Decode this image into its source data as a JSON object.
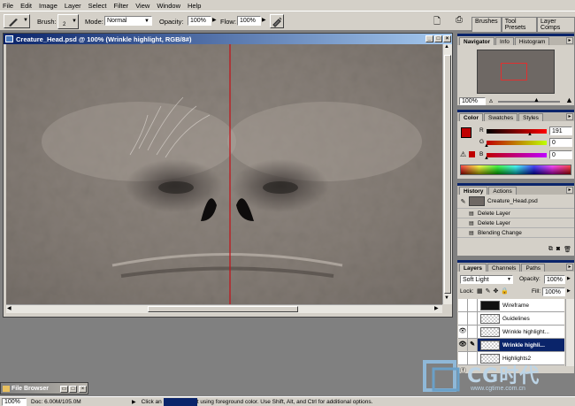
{
  "menu": [
    "File",
    "Edit",
    "Image",
    "Layer",
    "Select",
    "Filter",
    "View",
    "Window",
    "Help"
  ],
  "options": {
    "brush_label": "Brush:",
    "brush_size": "2",
    "mode_label": "Mode:",
    "mode_value": "Normal",
    "opacity_label": "Opacity:",
    "opacity_value": "100%",
    "flow_label": "Flow:",
    "flow_value": "100%",
    "palette_well_tabs": [
      "Brushes",
      "Tool Presets",
      "Layer Comps"
    ]
  },
  "document": {
    "title": "Creature_Head.psd @ 100% (Wrinkle highlight, RGB/8#)",
    "guide_color": "#c0161c"
  },
  "navigator": {
    "tabs": [
      "Navigator",
      "Info",
      "Histogram"
    ],
    "zoom": "100%",
    "view_box_color": "#e03030"
  },
  "color": {
    "tabs": [
      "Color",
      "Swatches",
      "Styles"
    ],
    "r_label": "R",
    "g_label": "G",
    "b_label": "B",
    "r_value": "191",
    "g_value": "0",
    "b_value": "0",
    "foreground": "#bf0000"
  },
  "history": {
    "tabs": [
      "History",
      "Actions"
    ],
    "snapshot": "Creature_Head.psd",
    "steps": [
      "Delete Layer",
      "Delete Layer",
      "Blending Change"
    ]
  },
  "layers": {
    "tabs": [
      "Layers",
      "Channels",
      "Paths"
    ],
    "blend_mode": "Soft Light",
    "opacity_label": "Opacity:",
    "opacity_value": "100%",
    "lock_label": "Lock:",
    "fill_label": "Fill:",
    "fill_value": "100%",
    "items": [
      {
        "name": "Wireframe",
        "visible": false,
        "active": false
      },
      {
        "name": "Guidelines",
        "visible": false,
        "active": false
      },
      {
        "name": "Wrinkle highlight...",
        "visible": true,
        "active": false
      },
      {
        "name": "Wrinkle highli...",
        "visible": true,
        "active": true
      },
      {
        "name": "Highlights2",
        "visible": false,
        "active": false
      }
    ]
  },
  "file_browser": {
    "title": "File Browser"
  },
  "status": {
    "zoom": "100%",
    "doc": "Doc: 6.00M/105.0M",
    "hint_prefix": "Click an",
    "hint_suffix": "t using foreground color.  Use Shift, Alt, and Ctrl for additional options."
  },
  "watermark": {
    "brand": "CG时代",
    "url": "www.cgtime.com.cn"
  }
}
